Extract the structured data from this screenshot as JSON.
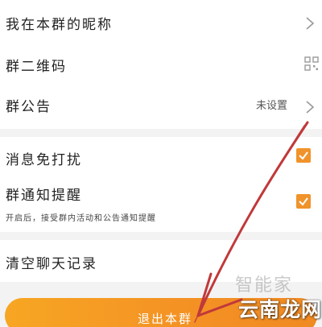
{
  "settings": {
    "nickname_label": "我在本群的昵称",
    "qrcode_label": "群二维码",
    "announcement_label": "群公告",
    "announcement_value": "未设置",
    "mute_label": "消息免打扰",
    "notify_label": "群通知提醒",
    "notify_desc": "开启后，接受群内活动和公告通知提醒",
    "clear_history_label": "清空聊天记录",
    "exit_button_label": "退出本群"
  },
  "toggles": {
    "mute_checked": true,
    "notify_checked": true
  },
  "colors": {
    "accent": "#f39c12",
    "annotation_arrow": "#c0393b"
  },
  "icons": {
    "nickname_row": "chevron-right-icon",
    "qrcode_row": "qrcode-icon",
    "announcement_row": "chevron-right-icon",
    "mute_row": "checkbox-checked-icon",
    "notify_row": "checkbox-checked-icon"
  },
  "watermark": {
    "logo_text": "智能家",
    "site_text": "云南龙网"
  }
}
